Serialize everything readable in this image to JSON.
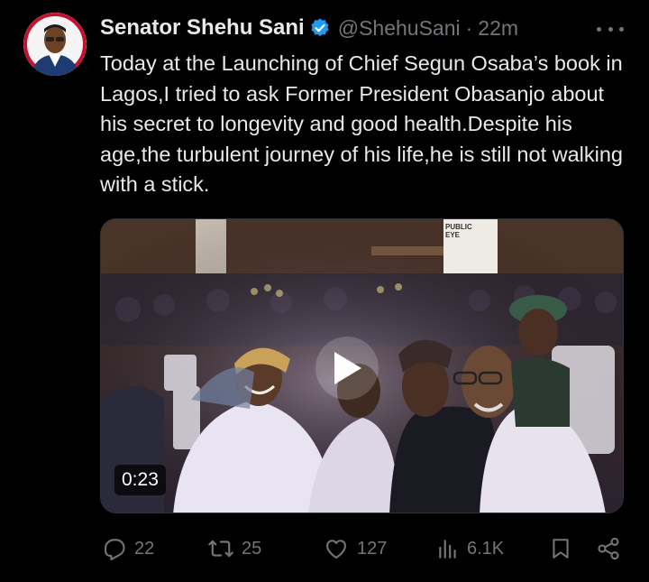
{
  "author": {
    "name": "Senator Shehu Sani",
    "handle": "@ShehuSani",
    "separator": "·",
    "time": "22m"
  },
  "tweet": {
    "text": "Today at the Launching of Chief Segun Osaba’s book in Lagos,I tried to ask Former President Obasanjo about his secret to longevity and good health.Despite his age,the turbulent journey of his life,he is still not walking with a stick."
  },
  "media": {
    "type": "video",
    "duration": "0:23",
    "banner_text": "PUBLIC EYE"
  },
  "actions": {
    "replies": "22",
    "reposts": "25",
    "likes": "127",
    "views": "6.1K"
  },
  "colors": {
    "background": "#000000",
    "primary_text": "#e7e9ea",
    "secondary_text": "#71767b",
    "verified_badge": "#1d9bf0"
  },
  "icons": {
    "verified": "verified-badge-icon",
    "more": "more-options-icon",
    "play": "play-icon",
    "reply": "reply-icon",
    "repost": "repost-icon",
    "like": "like-icon",
    "views": "views-icon",
    "bookmark": "bookmark-icon",
    "share": "share-icon"
  }
}
